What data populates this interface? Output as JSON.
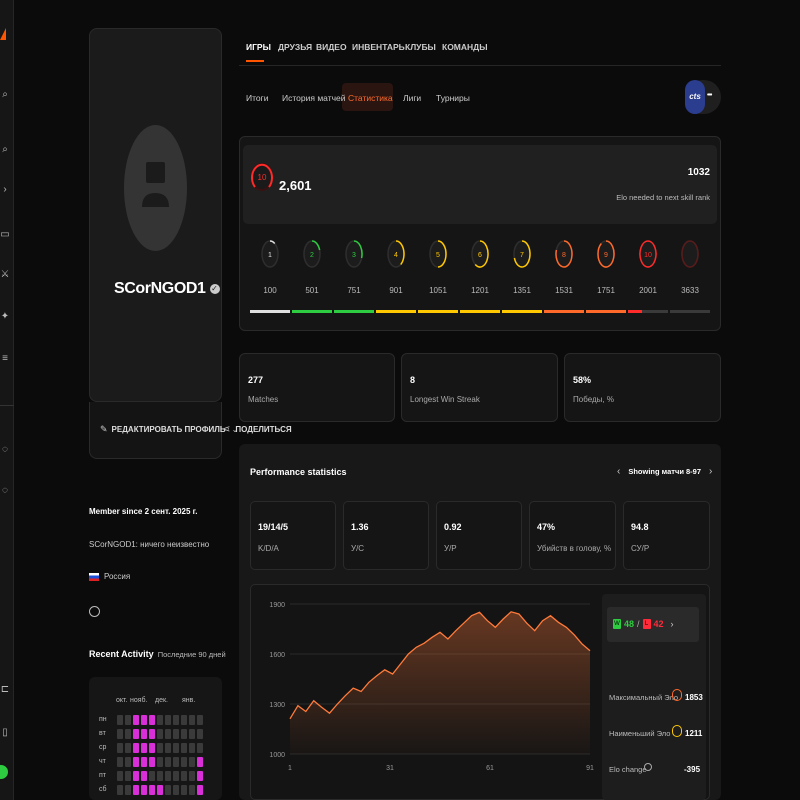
{
  "nav": {
    "tabs": [
      "ИГРЫ",
      "ДРУЗЬЯ",
      "ВИДЕО",
      "ИНВЕНТАРЬ",
      "КЛУБЫ",
      "КОМАНДЫ"
    ]
  },
  "subnav": {
    "tabs": [
      "Итоги",
      "История матчей",
      "Статистика",
      "Лиги",
      "Турниры"
    ],
    "game_badge": "cts",
    "more": "•••"
  },
  "profile": {
    "nickname": "SCorNGOD1",
    "edit_label": "РЕДАКТИРОВАТЬ ПРОФИЛЬ",
    "share_label": "ПОДЕЛИТЬСЯ",
    "member_since": "Member since 2 сент. 2025 г.",
    "bio": "SCorNGOD1: ничего неизвестно",
    "country": "Россия"
  },
  "elo": {
    "level": "10",
    "value": "2,601",
    "needed_value": "1032",
    "needed_label": "Elo needed to next skill rank",
    "levels": [
      {
        "n": "1",
        "threshold": "100",
        "color": "#e0e0e0"
      },
      {
        "n": "2",
        "threshold": "501",
        "color": "#2ecc40"
      },
      {
        "n": "3",
        "threshold": "751",
        "color": "#2ecc40"
      },
      {
        "n": "4",
        "threshold": "901",
        "color": "#ffc800"
      },
      {
        "n": "5",
        "threshold": "1051",
        "color": "#ffc800"
      },
      {
        "n": "6",
        "threshold": "1201",
        "color": "#ffc800"
      },
      {
        "n": "7",
        "threshold": "1351",
        "color": "#ffc800"
      },
      {
        "n": "8",
        "threshold": "1531",
        "color": "#ff6a2b"
      },
      {
        "n": "9",
        "threshold": "1751",
        "color": "#ff6a2b"
      },
      {
        "n": "10",
        "threshold": "2001",
        "color": "#ff2a2a"
      },
      {
        "n": "",
        "threshold": "3633",
        "color": "#5a1a1a"
      }
    ]
  },
  "summary": [
    {
      "value": "277",
      "label": "Matches"
    },
    {
      "value": "8",
      "label": "Longest Win Streak"
    },
    {
      "value": "58%",
      "label": "Победы, %"
    }
  ],
  "performance": {
    "title": "Performance statistics",
    "range": "Showing матчи 8-97",
    "stats": [
      {
        "value": "19/14/5",
        "label": "K/D/A"
      },
      {
        "value": "1.36",
        "label": "У/С"
      },
      {
        "value": "0.92",
        "label": "У/Р"
      },
      {
        "value": "47%",
        "label": "Убийств в голову, %"
      },
      {
        "value": "94.8",
        "label": "СУ/Р"
      }
    ],
    "wins": "48",
    "losses": "42",
    "win_badge": "W",
    "loss_badge": "L",
    "max_elo_label": "Максимальный Эло",
    "max_elo": "1853",
    "min_elo_label": "Наименьший Эло",
    "min_elo": "1211",
    "elo_change_label": "Elo change",
    "elo_change": "-395"
  },
  "chart_data": {
    "type": "area",
    "x_ticks": [
      "1",
      "31",
      "61",
      "91"
    ],
    "y_ticks": [
      "1000",
      "1300",
      "1600",
      "1900"
    ],
    "ylim": [
      1000,
      1900
    ],
    "xlim": [
      1,
      91
    ],
    "color": "#ff7a3a",
    "values": [
      1211,
      1290,
      1255,
      1320,
      1280,
      1245,
      1300,
      1350,
      1395,
      1375,
      1430,
      1470,
      1505,
      1480,
      1540,
      1600,
      1640,
      1665,
      1700,
      1730,
      1690,
      1740,
      1785,
      1830,
      1850,
      1800,
      1760,
      1810,
      1853,
      1840,
      1785,
      1740,
      1800,
      1830,
      1790,
      1760,
      1715,
      1660,
      1620
    ]
  },
  "activity": {
    "title": "Recent Activity",
    "range": "Последние 90 дней",
    "months": [
      "окт.",
      "нояб.",
      "дек.",
      "янв."
    ],
    "days": [
      "пн",
      "вт",
      "ср",
      "чт",
      "пт",
      "сб"
    ]
  }
}
